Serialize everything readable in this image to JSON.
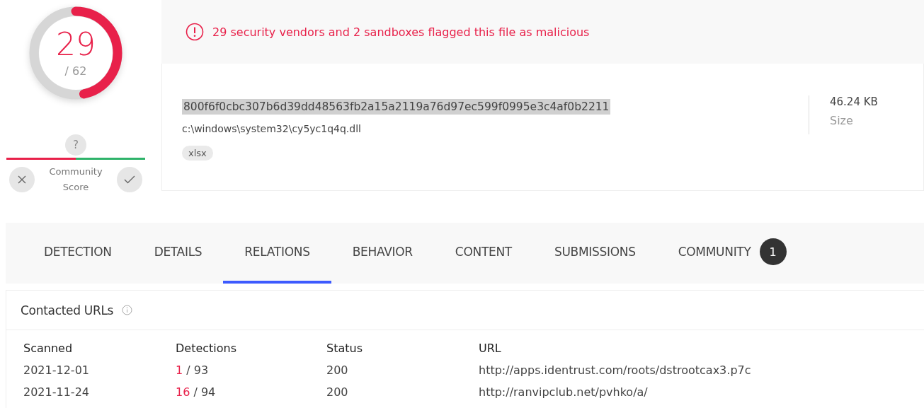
{
  "score": {
    "detections": "29",
    "total": "/ 62",
    "level": 0.468
  },
  "community": {
    "label": "Community Score",
    "bubble": "?"
  },
  "alert": "29 security vendors and 2 sandboxes flagged this file as malicious",
  "file": {
    "hash": "800f6f0cbc307b6d39dd48563fb2a15a2119a76d97ec599f0995e3c4af0b2211",
    "hash_highlighted": true,
    "path": "c:\\windows\\system32\\cy5yc1q4q.dll",
    "tags": [
      "xlsx"
    ],
    "size": "46.24 KB",
    "size_label": "Size"
  },
  "tabs": [
    {
      "label": "DETECTION",
      "selected": false
    },
    {
      "label": "DETAILS",
      "selected": false
    },
    {
      "label": "RELATIONS",
      "selected": true
    },
    {
      "label": "BEHAVIOR",
      "selected": false
    },
    {
      "label": "CONTENT",
      "selected": false
    },
    {
      "label": "SUBMISSIONS",
      "selected": false
    },
    {
      "label": "COMMUNITY",
      "selected": false,
      "badge": "1"
    }
  ],
  "section": {
    "title": "Contacted URLs",
    "columns": [
      "Scanned",
      "Detections",
      "Status",
      "URL"
    ],
    "rows": [
      {
        "scanned": "2021-12-01",
        "positives": "1",
        "total": "/ 93",
        "status": "200",
        "url": "http://apps.identrust.com/roots/dstrootcax3.p7c"
      },
      {
        "scanned": "2021-11-24",
        "positives": "16",
        "total": "/ 94",
        "status": "200",
        "url": "http://ranvipclub.net/pvhko/a/"
      }
    ]
  }
}
